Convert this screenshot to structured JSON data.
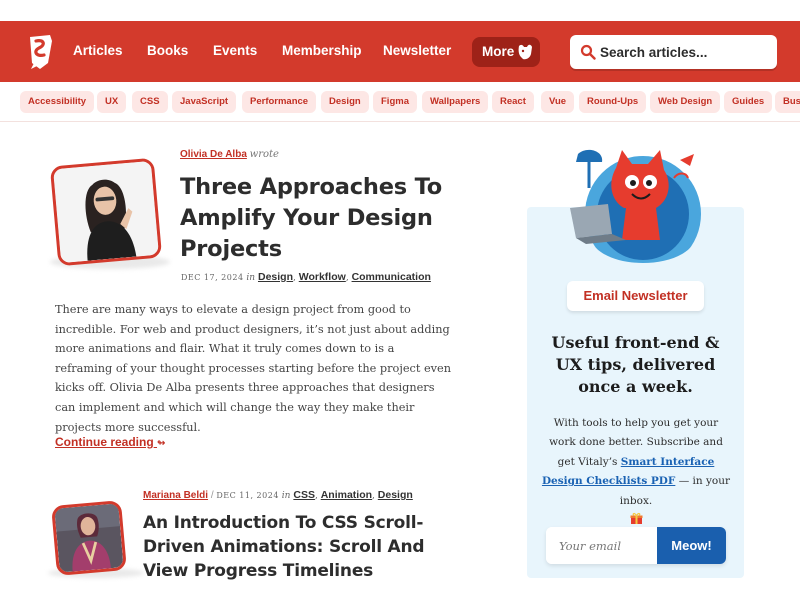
{
  "header": {
    "logo_letter": "S",
    "nav": [
      "Articles",
      "Books",
      "Events",
      "Membership",
      "Newsletter"
    ],
    "more_label": "More",
    "search_placeholder": "Search articles...",
    "brand_color": "#d33a2c"
  },
  "tags": [
    "Accessibility",
    "UX",
    "CSS",
    "JavaScript",
    "Performance",
    "Design",
    "Figma",
    "Wallpapers",
    "React",
    "Vue",
    "Round-Ups",
    "Web Design",
    "Guides",
    "Bus"
  ],
  "articles": [
    {
      "author": "Olivia De Alba",
      "wrote": "wrote",
      "title_lines": [
        "Three Approaches To",
        "Amplify Your Design",
        "Projects"
      ],
      "date": "Dec 17, 2024",
      "in": "in",
      "categories": [
        "Design",
        "Workflow",
        "Communication"
      ],
      "excerpt": "There are many ways to elevate a design project from good to incredible. For web and product designers, it’s not just about adding more animations and flair. What it truly comes down to is a reframing of your thought processes starting before the project even kicks off. Olivia De Alba presents three approaches that designers can implement and which will change the way they make their projects more successful.",
      "continue_label": "Continue reading",
      "continue_icon": "↬"
    },
    {
      "author": "Mariana Beldi",
      "separator": "/",
      "date": "Dec 11, 2024",
      "in": "in",
      "categories": [
        "CSS",
        "Animation",
        "Design"
      ],
      "title_lines": [
        "An Introduction To CSS Scroll-",
        "Driven Animations: Scroll And",
        "View Progress Timelines"
      ]
    }
  ],
  "sidebar": {
    "badge": "Email Newsletter",
    "heading": "Useful front-end & UX tips, delivered once a week.",
    "text_before": "With tools to help you get your work done better. Subscribe and get Vitaly’s",
    "link": "Smart Interface Design Checklists PDF",
    "text_after": "— in your inbox.",
    "email_placeholder": "Your email",
    "button": "Meow!"
  }
}
